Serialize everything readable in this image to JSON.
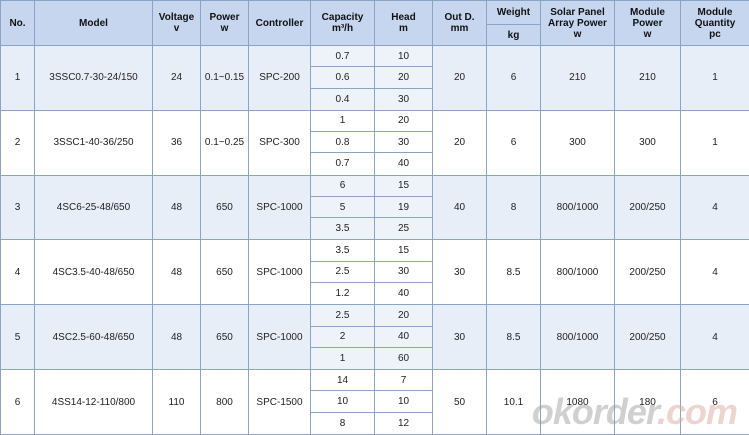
{
  "header": {
    "no": "No.",
    "model": "Model",
    "voltage": [
      "Voltage",
      "v"
    ],
    "power": [
      "Power",
      "w"
    ],
    "controller": "Controller",
    "capacity": [
      "Capacity",
      "m³/h"
    ],
    "head": [
      "Head",
      "m"
    ],
    "outd": [
      "Out D.",
      "mm"
    ],
    "weight": [
      "Weight",
      "kg"
    ],
    "solar": [
      "Solar Panel",
      "Array Power",
      "w"
    ],
    "module_power": [
      "Module",
      "Power",
      "w"
    ],
    "module_qty": [
      "Module",
      "Quantity",
      "pc"
    ]
  },
  "rows": [
    {
      "no": "1",
      "model": "3SSC0.7-30-24/150",
      "voltage": "24",
      "power": "0.1~0.15",
      "controller": "SPC-200",
      "sub": [
        {
          "capacity": "0.7",
          "head": "10"
        },
        {
          "capacity": "0.6",
          "head": "20"
        },
        {
          "capacity": "0.4",
          "head": "30"
        }
      ],
      "outd": "20",
      "weight": "6",
      "solar": "210",
      "module_power": "210",
      "module_qty": "1"
    },
    {
      "no": "2",
      "model": "3SSC1-40-36/250",
      "voltage": "36",
      "power": "0.1~0.25",
      "controller": "SPC-300",
      "sub": [
        {
          "capacity": "1",
          "head": "20"
        },
        {
          "capacity": "0.8",
          "head": "30"
        },
        {
          "capacity": "0.7",
          "head": "40"
        }
      ],
      "outd": "20",
      "weight": "6",
      "solar": "300",
      "module_power": "300",
      "module_qty": "1"
    },
    {
      "no": "3",
      "model": "4SC6-25-48/650",
      "voltage": "48",
      "power": "650",
      "controller": "SPC-1000",
      "sub": [
        {
          "capacity": "6",
          "head": "15"
        },
        {
          "capacity": "5",
          "head": "19"
        },
        {
          "capacity": "3.5",
          "head": "25"
        }
      ],
      "outd": "40",
      "weight": "8",
      "solar": "800/1000",
      "module_power": "200/250",
      "module_qty": "4"
    },
    {
      "no": "4",
      "model": "4SC3.5-40-48/650",
      "voltage": "48",
      "power": "650",
      "controller": "SPC-1000",
      "sub": [
        {
          "capacity": "3.5",
          "head": "15"
        },
        {
          "capacity": "2.5",
          "head": "30"
        },
        {
          "capacity": "1.2",
          "head": "40"
        }
      ],
      "outd": "30",
      "weight": "8.5",
      "solar": "800/1000",
      "module_power": "200/250",
      "module_qty": "4"
    },
    {
      "no": "5",
      "model": "4SC2.5-60-48/650",
      "voltage": "48",
      "power": "650",
      "controller": "SPC-1000",
      "sub": [
        {
          "capacity": "2.5",
          "head": "20"
        },
        {
          "capacity": "2",
          "head": "40"
        },
        {
          "capacity": "1",
          "head": "60"
        }
      ],
      "outd": "30",
      "weight": "8.5",
      "solar": "800/1000",
      "module_power": "200/250",
      "module_qty": "4"
    },
    {
      "no": "6",
      "model": "4SS14-12-110/800",
      "voltage": "110",
      "power": "800",
      "controller": "SPC-1500",
      "sub": [
        {
          "capacity": "14",
          "head": "7"
        },
        {
          "capacity": "10",
          "head": "10"
        },
        {
          "capacity": "8",
          "head": "12"
        }
      ],
      "outd": "50",
      "weight": "10.1",
      "solar": "1080",
      "module_power": "180",
      "module_qty": "6"
    }
  ],
  "watermark": {
    "part1": "okorder",
    "part2": ".com"
  }
}
